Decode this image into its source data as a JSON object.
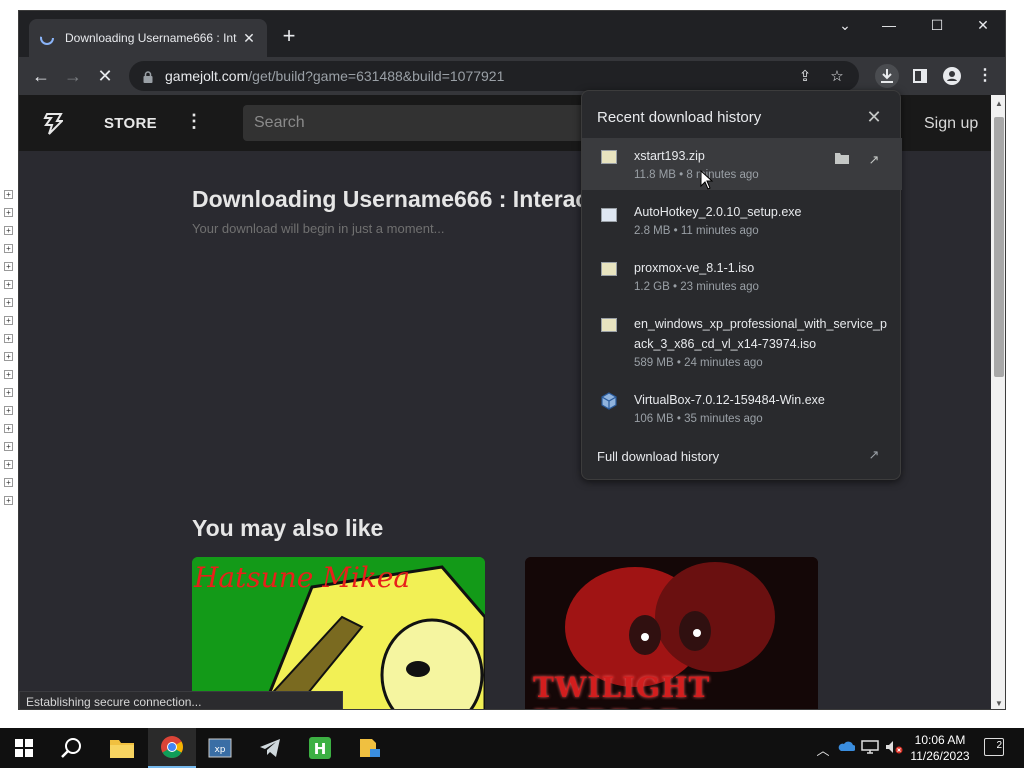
{
  "browser": {
    "tab_title": "Downloading Username666 : Int",
    "new_tab_symbol": "+",
    "url_host": "gamejolt.com",
    "url_path": "/get/build?game=631488&build=1077921",
    "status_text": "Establishing secure connection..."
  },
  "site": {
    "store_label": "STORE",
    "search_placeholder": "Search",
    "signup_label": "Sign up",
    "download_title": "Downloading Username666 : Interac",
    "download_subtitle": "Your download will begin in just a moment...",
    "also_like_heading": "You may also like",
    "thumbnails": [
      {
        "title": "Hatsune Mikea",
        "color": "#139a18"
      },
      {
        "title": "TWILIGHT HORROR",
        "color": "#d21e1e"
      }
    ]
  },
  "downloads_panel": {
    "title": "Recent download history",
    "full_history_label": "Full download history",
    "items": [
      {
        "name": "xstart193.zip",
        "size": "11.8 MB",
        "age": "8 minutes ago",
        "icon": "zip-file-icon"
      },
      {
        "name": "AutoHotkey_2.0.10_setup.exe",
        "size": "2.8 MB",
        "age": "11 minutes ago",
        "icon": "exe-file-icon"
      },
      {
        "name": "proxmox-ve_8.1-1.iso",
        "size": "1.2 GB",
        "age": "23 minutes ago",
        "icon": "iso-file-icon"
      },
      {
        "name": "en_windows_xp_professional_with_service_pack_3_x86_cd_vl_x14-73974.iso",
        "size": "589 MB",
        "age": "24 minutes ago",
        "icon": "iso-file-icon"
      },
      {
        "name": "VirtualBox-7.0.12-159484-Win.exe",
        "size": "106 MB",
        "age": "35 minutes ago",
        "icon": "virtualbox-icon"
      }
    ]
  },
  "taskbar": {
    "time": "10:06 AM",
    "date": "11/26/2023",
    "notification_count": "2"
  },
  "colors": {
    "accent": "#76b9ed",
    "page_bg": "#2a2a30",
    "panel_bg": "#292a2d"
  }
}
